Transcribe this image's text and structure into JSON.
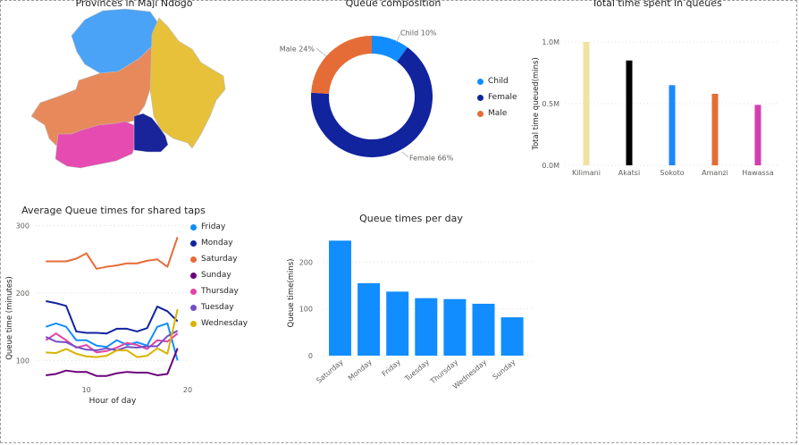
{
  "map": {
    "title": "Provinces in Maji Ndogo",
    "colors": [
      "#4aa3f7",
      "#e8895c",
      "#e7c13a",
      "#e54bb0",
      "#19239a"
    ]
  },
  "donut": {
    "title": "Queue composition",
    "chart_data": {
      "type": "pie",
      "title": "Queue composition",
      "slices": [
        {
          "name": "Child",
          "value": 10,
          "label": "Child 10%",
          "color": "#118dff"
        },
        {
          "name": "Female",
          "value": 66,
          "label": "Female 66%",
          "color": "#12239e"
        },
        {
          "name": "Male",
          "value": 24,
          "label": "Male 24%",
          "color": "#e66c37"
        }
      ],
      "legend": [
        "Child",
        "Female",
        "Male"
      ],
      "legend_position": "right"
    }
  },
  "total": {
    "title": "Total time spent in queues",
    "chart_data": {
      "type": "bar",
      "title": "Total time spent in queues",
      "ylabel": "Total time queued(mins)",
      "categories": [
        "Kilimani",
        "Akatsi",
        "Sokoto",
        "Amanzi",
        "Hawassa"
      ],
      "values": [
        1000000,
        850000,
        650000,
        580000,
        490000
      ],
      "colors": [
        "#f2e2a1",
        "#000000",
        "#1e88ff",
        "#e66c37",
        "#d33fb2"
      ],
      "yticks": [
        "0.0M",
        "0.5M",
        "1.0M"
      ],
      "ylim": [
        0,
        1000000
      ],
      "grid": true
    }
  },
  "avg": {
    "title": "Average Queue times for shared taps",
    "chart_data": {
      "type": "line",
      "title": "Average Queue times for shared taps",
      "xlabel": "Hour of day",
      "ylabel": "Queue time (minutes)",
      "x": [
        6,
        7,
        8,
        9,
        10,
        11,
        12,
        13,
        14,
        15,
        16,
        17,
        18,
        19
      ],
      "xticks": [
        "10",
        "20"
      ],
      "yticks": [
        "100",
        "200",
        "300"
      ],
      "xlim": [
        5,
        20
      ],
      "ylim": [
        70,
        310
      ],
      "legend_position": "right",
      "grid": true,
      "series": [
        {
          "name": "Friday",
          "color": "#118dff",
          "values": [
            150,
            155,
            150,
            130,
            130,
            122,
            120,
            130,
            123,
            127,
            122,
            150,
            155,
            100
          ]
        },
        {
          "name": "Monday",
          "color": "#12239e",
          "values": [
            188,
            185,
            181,
            143,
            141,
            141,
            140,
            147,
            147,
            143,
            148,
            180,
            173,
            158
          ]
        },
        {
          "name": "Saturday",
          "color": "#e66c37",
          "values": [
            247,
            247,
            247,
            251,
            259,
            236,
            239,
            241,
            244,
            244,
            248,
            250,
            239,
            283
          ]
        },
        {
          "name": "Sunday",
          "color": "#6b007b",
          "values": [
            78,
            80,
            85,
            83,
            83,
            77,
            77,
            81,
            83,
            82,
            82,
            78,
            80,
            118
          ]
        },
        {
          "name": "Thursday",
          "color": "#e044a7",
          "values": [
            130,
            140,
            130,
            119,
            123,
            112,
            114,
            119,
            126,
            123,
            117,
            130,
            128,
            140
          ]
        },
        {
          "name": "Tuesday",
          "color": "#744ec2",
          "values": [
            135,
            128,
            127,
            120,
            116,
            115,
            118,
            115,
            120,
            119,
            121,
            121,
            136,
            144
          ]
        },
        {
          "name": "Wednesday",
          "color": "#d9b300",
          "values": [
            112,
            111,
            117,
            110,
            106,
            105,
            107,
            115,
            115,
            105,
            107,
            118,
            110,
            176
          ]
        }
      ]
    }
  },
  "perday": {
    "title": "Queue times per day",
    "chart_data": {
      "type": "bar",
      "title": "Queue times per day",
      "ylabel": "Queue time(mins)",
      "categories": [
        "Saturday",
        "Monday",
        "Friday",
        "Tuesday",
        "Thursday",
        "Wednesday",
        "Sunday"
      ],
      "values": [
        246,
        155,
        137,
        123,
        121,
        111,
        82
      ],
      "color": "#118dff",
      "yticks": [
        "0",
        "100",
        "200"
      ],
      "ylim": [
        0,
        260
      ],
      "grid": true
    }
  }
}
